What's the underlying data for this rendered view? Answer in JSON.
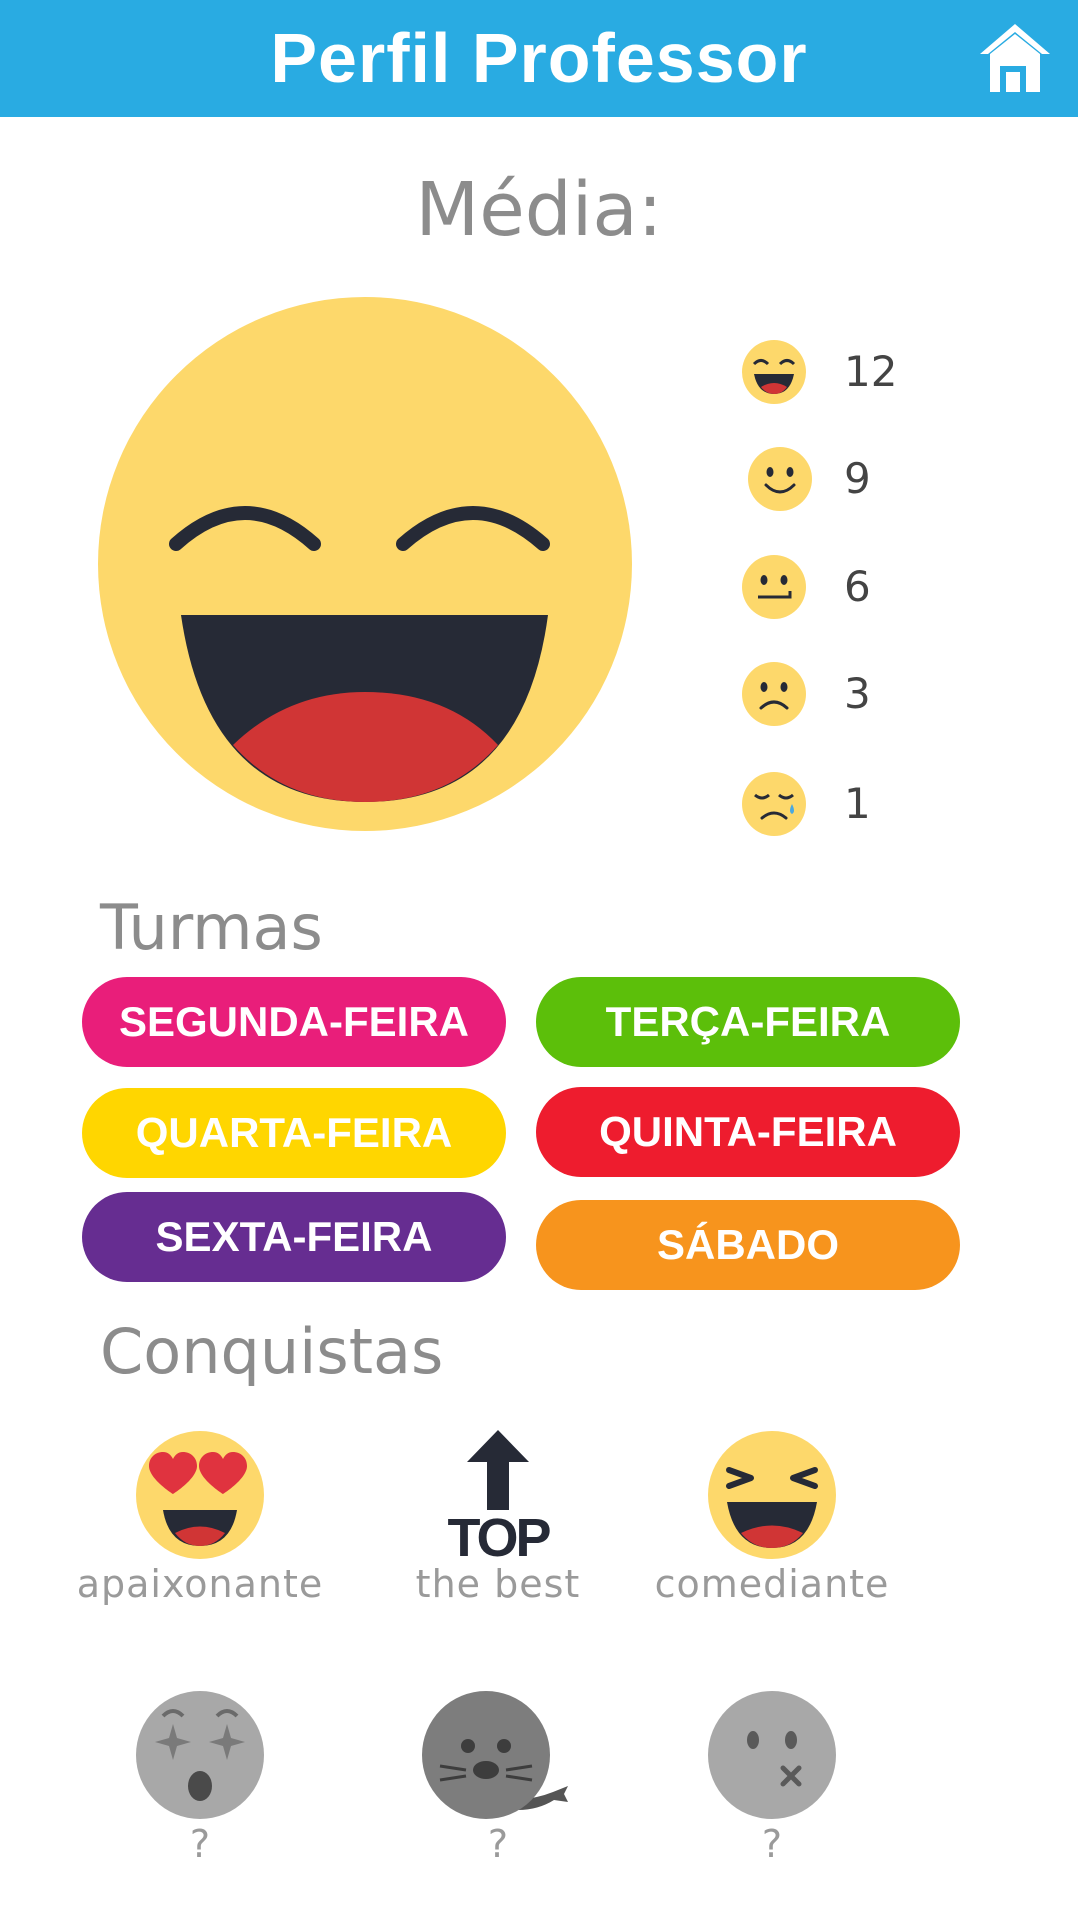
{
  "header": {
    "title": "Perfil Professor",
    "home_icon": "home-icon",
    "color": "#29abe2"
  },
  "average": {
    "title": "Média:",
    "face_icon": "laughing-face-icon",
    "ratings": [
      {
        "icon": "grinning-face-icon",
        "count": "12"
      },
      {
        "icon": "smiling-face-icon",
        "count": "9"
      },
      {
        "icon": "neutral-face-icon",
        "count": "6"
      },
      {
        "icon": "frowning-face-icon",
        "count": "3"
      },
      {
        "icon": "crying-face-icon",
        "count": "1"
      }
    ]
  },
  "classes": {
    "title": "Turmas",
    "items": [
      {
        "label": "SEGUNDA-FEIRA",
        "color": "#e91e7a"
      },
      {
        "label": "TERÇA-FEIRA",
        "color": "#5cbf0a"
      },
      {
        "label": "QUARTA-FEIRA",
        "color": "#ffd600"
      },
      {
        "label": "QUINTA-FEIRA",
        "color": "#ee1c2e"
      },
      {
        "label": "SEXTA-FEIRA",
        "color": "#662d91"
      },
      {
        "label": "SÁBADO",
        "color": "#f7941d"
      }
    ]
  },
  "achievements": {
    "title": "Conquistas",
    "items": [
      {
        "label": "apaixonante",
        "icon": "heart-eyes-face-icon",
        "unlocked": true
      },
      {
        "label": "the best",
        "icon": "top-arrow-icon",
        "badge_text": "TOP",
        "unlocked": true
      },
      {
        "label": "comediante",
        "icon": "squinting-laugh-face-icon",
        "unlocked": true
      },
      {
        "label": "?",
        "icon": "star-struck-face-icon",
        "unlocked": false
      },
      {
        "label": "?",
        "icon": "seal-icon",
        "unlocked": false
      },
      {
        "label": "?",
        "icon": "zipped-mouth-face-icon",
        "unlocked": false
      }
    ]
  }
}
